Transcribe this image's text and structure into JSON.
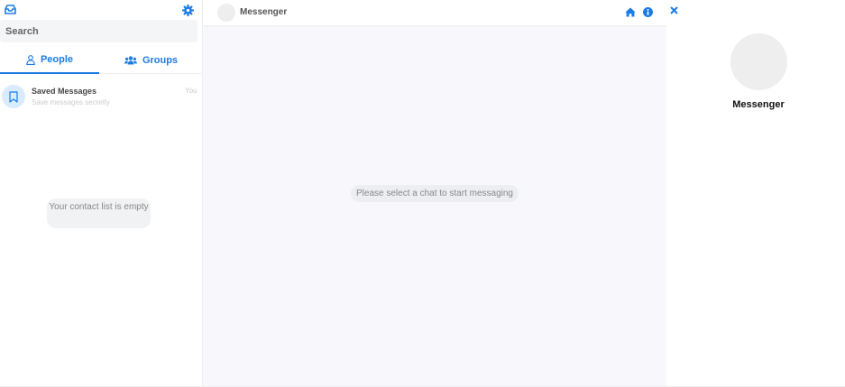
{
  "sidebar": {
    "search": {
      "placeholder": "Search"
    },
    "tabs": [
      {
        "label": "People",
        "icon": "user-icon",
        "active": true
      },
      {
        "label": "Groups",
        "icon": "users-icon",
        "active": false
      }
    ],
    "saved_messages": {
      "title": "Saved Messages",
      "subtitle": "Save messages secretly",
      "meta": "You",
      "icon": "bookmark-icon"
    },
    "empty_contacts": "Your contact list is empty"
  },
  "chat": {
    "header_title": "Messenger",
    "placeholder_message": "Please select a chat to start messaging"
  },
  "info_panel": {
    "title": "Messenger"
  },
  "colors": {
    "accent": "#1d7ce4",
    "center_bg": "#f8f8fc",
    "avatar_bg": "#eeeeee"
  }
}
